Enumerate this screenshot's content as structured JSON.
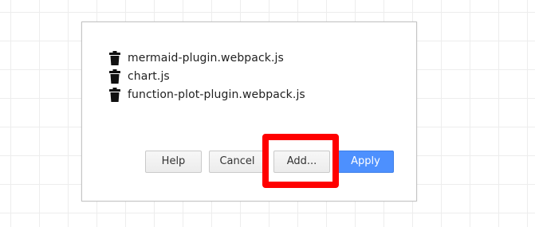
{
  "dialog": {
    "files": [
      {
        "name": "mermaid-plugin.webpack.js",
        "icon": "trash-icon"
      },
      {
        "name": "chart.js",
        "icon": "trash-icon"
      },
      {
        "name": "function-plot-plugin.webpack.js",
        "icon": "trash-icon"
      }
    ],
    "buttons": {
      "help": "Help",
      "cancel": "Cancel",
      "add": "Add...",
      "apply": "Apply"
    }
  },
  "colors": {
    "apply_button": "#4d90fe",
    "highlight": "#ff0000"
  }
}
